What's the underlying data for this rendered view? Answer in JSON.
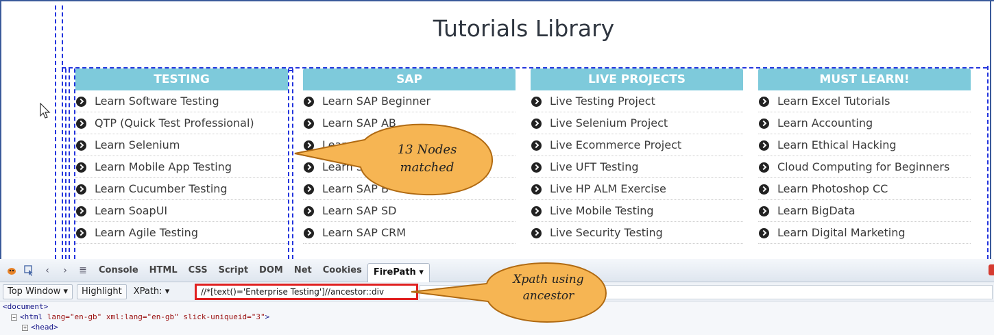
{
  "page": {
    "title": "Tutorials Library"
  },
  "columns": [
    {
      "heading": "TESTING",
      "items": [
        "Learn Software Testing",
        "QTP (Quick Test Professional)",
        "Learn Selenium",
        "Learn Mobile App Testing",
        "Learn Cucumber Testing",
        "Learn SoapUI",
        "Learn Agile Testing"
      ]
    },
    {
      "heading": "SAP",
      "items": [
        "Learn SAP Beginner",
        "Learn SAP AB",
        "Learn SAP",
        "Learn SAP",
        "Learn SAP B",
        "Learn SAP SD",
        "Learn SAP CRM"
      ]
    },
    {
      "heading": "LIVE PROJECTS",
      "items": [
        "Live Testing Project",
        "Live Selenium Project",
        "Live Ecommerce Project",
        "Live UFT Testing",
        "Live HP ALM Exercise",
        "Live Mobile Testing",
        "Live Security Testing"
      ]
    },
    {
      "heading": "MUST LEARN!",
      "items": [
        "Learn Excel Tutorials",
        "Learn Accounting",
        "Learn Ethical Hacking",
        "Cloud Computing for Beginners",
        "Learn Photoshop CC",
        "Learn BigData",
        "Learn Digital Marketing"
      ]
    }
  ],
  "callouts": {
    "nodes": [
      "13 Nodes",
      "matched"
    ],
    "xpath": [
      "Xpath using",
      "ancestor"
    ]
  },
  "firebug": {
    "tabs": [
      "Console",
      "HTML",
      "CSS",
      "Script",
      "DOM",
      "Net",
      "Cookies"
    ],
    "active_tab": "FirePath",
    "active_tab_arrow": "▾",
    "top_window": "Top Window",
    "highlight": "Highlight",
    "xpath_label": "XPath:",
    "xpath_value": "//*[text()='Enterprise Testing']//ancestor::div",
    "tree": [
      {
        "tag": "<document>"
      },
      {
        "tag": "<html",
        "attrs": " lang=\"en-gb\" xml:lang=\"en-gb\" slick-uniqueid=\"3\"",
        "end": ">"
      },
      {
        "tag": "<head>"
      }
    ]
  },
  "colors": {
    "header": "#7ecadb",
    "callout": "#f6b553",
    "highlight_border": "#e02020",
    "dashes": "#2233dd"
  }
}
